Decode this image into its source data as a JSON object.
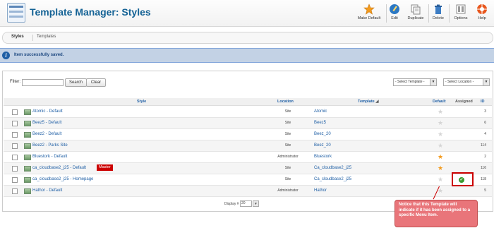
{
  "page": {
    "title": "Template Manager: Styles"
  },
  "toolbar": {
    "make_default": "Make Default",
    "edit": "Edit",
    "duplicate": "Duplicate",
    "delete": "Delete",
    "options": "Options",
    "help": "Help"
  },
  "tabs": [
    {
      "label": "Styles",
      "active": true
    },
    {
      "label": "Templates",
      "active": false
    }
  ],
  "message": "Item successfully saved.",
  "filter": {
    "label": "Filter:",
    "value": "",
    "search_label": "Search",
    "clear_label": "Clear",
    "template_select": "- Select Template -",
    "location_select": "- Select Location -"
  },
  "table": {
    "headers": {
      "style": "Style",
      "location": "Location",
      "template": "Template",
      "default": "Default",
      "assigned": "Assigned",
      "id": "ID"
    },
    "rows": [
      {
        "style": "Atomic - Default",
        "location": "Site",
        "template": "Atomic",
        "default": false,
        "assigned": false,
        "id": "3"
      },
      {
        "style": "Beez5 - Default",
        "location": "Site",
        "template": "Beez5",
        "default": false,
        "assigned": false,
        "id": "6"
      },
      {
        "style": "Beez2 - Default",
        "location": "Site",
        "template": "Beez_20",
        "default": false,
        "assigned": false,
        "id": "4"
      },
      {
        "style": "Beez2 - Parks Site",
        "location": "Site",
        "template": "Beez_20",
        "default": false,
        "assigned": false,
        "id": "114"
      },
      {
        "style": "Bluestork - Default",
        "location": "Administrator",
        "template": "Bluestork",
        "default": true,
        "assigned": false,
        "id": "2"
      },
      {
        "style": "ca_cloudbase2_j25 - Default",
        "badge": "Master",
        "location": "Site",
        "template": "Ca_cloudbase2_j25",
        "default": true,
        "assigned": false,
        "id": "116"
      },
      {
        "style": "ca_cloudbase2_j25 - Homepage",
        "location": "Site",
        "template": "Ca_cloudbase2_j25",
        "default": false,
        "assigned": true,
        "id": "118"
      },
      {
        "style": "Hathor - Default",
        "location": "Administrator",
        "template": "Hathor",
        "default": false,
        "assigned": false,
        "id": "5"
      }
    ]
  },
  "pagination": {
    "display_label": "Display #",
    "display_value": "20"
  },
  "callout": {
    "text": "Notice that this Template will indicate if it has been assigned to a specific Menu Item."
  },
  "colors": {
    "accent": "#146295",
    "link": "#1f5fa5",
    "master_badge": "#cc0000",
    "callout_bg": "#e9757a",
    "star_default": "#f39b1f"
  }
}
